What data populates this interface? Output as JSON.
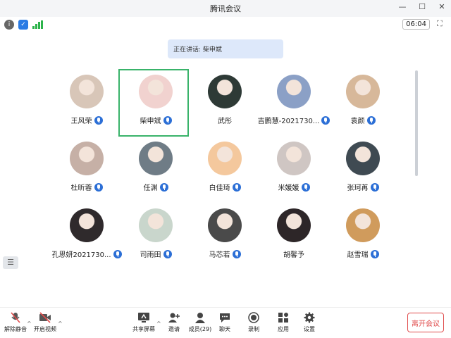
{
  "window": {
    "title": "腾讯会议",
    "controls": [
      "—",
      "☐",
      "✕"
    ]
  },
  "status": {
    "timer": "06:04"
  },
  "banner": {
    "speaking": "正在讲话: 柴申斌"
  },
  "participants": [
    {
      "name": "王风荣",
      "mic": true,
      "avatar_color": "#d8c6b8"
    },
    {
      "name": "柴申斌",
      "mic": true,
      "avatar_color": "#f1d2cf",
      "active": true
    },
    {
      "name": "武彤",
      "mic": false,
      "avatar_color": "#2e3a36"
    },
    {
      "name": "吉鹏慧-2021730...",
      "mic": true,
      "avatar_color": "#8ba0c6"
    },
    {
      "name": "袁颜",
      "mic": true,
      "avatar_color": "#d7b89a"
    },
    {
      "name": "杜昕蓉",
      "mic": true,
      "avatar_color": "#c6b0a6"
    },
    {
      "name": "任渊",
      "mic": true,
      "avatar_color": "#6f7c86"
    },
    {
      "name": "白佳琦",
      "mic": true,
      "avatar_color": "#f4c89d"
    },
    {
      "name": "米媛媛",
      "mic": true,
      "avatar_color": "#cfc6c3"
    },
    {
      "name": "张珂苒",
      "mic": true,
      "avatar_color": "#3f4a52"
    },
    {
      "name": "孔思妍2021730...",
      "mic": true,
      "avatar_color": "#2f2a2c"
    },
    {
      "name": "司雨田",
      "mic": true,
      "avatar_color": "#c9d6cc"
    },
    {
      "name": "马芯若",
      "mic": true,
      "avatar_color": "#4a4a4a"
    },
    {
      "name": "胡馨予",
      "mic": false,
      "avatar_color": "#2d2628"
    },
    {
      "name": "赵雪瑞",
      "mic": true,
      "avatar_color": "#d09b5c"
    }
  ],
  "bottom_bar": {
    "mute": "解除静音",
    "video": "开启视频",
    "share": "共享屏幕",
    "invite": "邀请",
    "members": "成员(29)",
    "chat": "聊天",
    "record": "录制",
    "apps": "应用",
    "settings": "设置",
    "leave": "离开会议"
  }
}
